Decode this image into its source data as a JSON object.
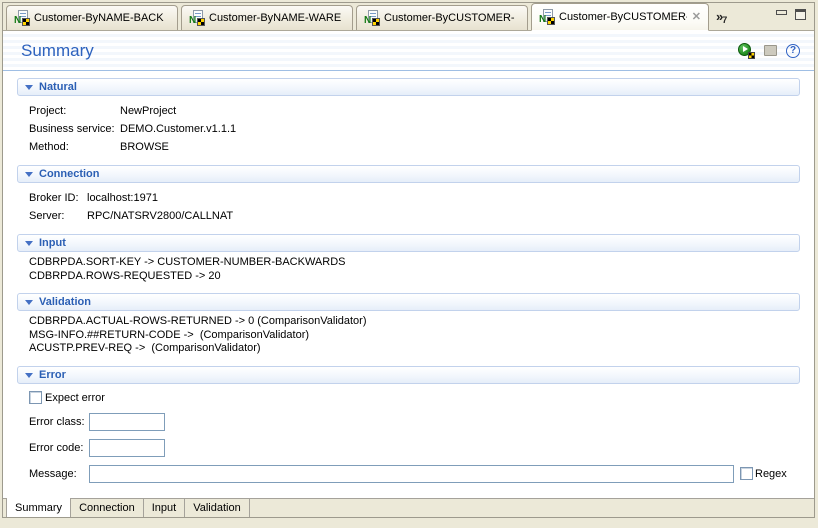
{
  "editor_tabs": {
    "tabs": [
      {
        "label": "Customer-ByNAME-BACK",
        "active": false
      },
      {
        "label": "Customer-ByNAME-WARE",
        "active": false
      },
      {
        "label": "Customer-ByCUSTOMER-",
        "active": false
      },
      {
        "label": "Customer-ByCUSTOMER-",
        "active": true
      }
    ],
    "close_glyph": "✕",
    "overflow_chevron": "»",
    "overflow_count": "7"
  },
  "header": {
    "title": "Summary",
    "icons": [
      {
        "name": "run-test-icon"
      },
      {
        "name": "stop-icon"
      },
      {
        "name": "help-icon",
        "glyph": "?"
      }
    ]
  },
  "sections": {
    "natural": {
      "title": "Natural",
      "rows": [
        {
          "label": "Project:",
          "value": "NewProject"
        },
        {
          "label": "Business service:",
          "value": "DEMO.Customer.v1.1.1"
        },
        {
          "label": "Method:",
          "value": "BROWSE"
        }
      ]
    },
    "connection": {
      "title": "Connection",
      "rows": [
        {
          "label": "Broker ID:",
          "value": "localhost:1971"
        },
        {
          "label": "Server:",
          "value": "RPC/NATSRV2800/CALLNAT"
        }
      ]
    },
    "input": {
      "title": "Input",
      "lines": [
        "CDBRPDA.SORT-KEY -> CUSTOMER-NUMBER-BACKWARDS",
        "CDBRPDA.ROWS-REQUESTED -> 20"
      ]
    },
    "validation": {
      "title": "Validation",
      "lines": [
        "CDBRPDA.ACTUAL-ROWS-RETURNED -> 0 (ComparisonValidator)",
        "MSG-INFO.##RETURN-CODE ->  (ComparisonValidator)",
        "ACUSTP.PREV-REQ ->  (ComparisonValidator)"
      ]
    },
    "error": {
      "title": "Error",
      "expect_error_label": "Expect error",
      "expect_error_checked": false,
      "fields": [
        {
          "label": "Error class:",
          "value": ""
        },
        {
          "label": "Error code:",
          "value": ""
        }
      ],
      "message_label": "Message:",
      "message_value": "",
      "regex_label": "Regex",
      "regex_checked": false
    }
  },
  "bottom_tabs": [
    {
      "label": "Summary",
      "active": true
    },
    {
      "label": "Connection",
      "active": false
    },
    {
      "label": "Input",
      "active": false
    },
    {
      "label": "Validation",
      "active": false
    }
  ],
  "colors": {
    "shell_background": "#ECE9D8",
    "title_blue": "#2D62BE",
    "section_title_blue": "#2B5FB4",
    "section_border": "#C2D2EC",
    "input_border": "#7F9DB9",
    "header_separator": "#9FBEE4"
  }
}
